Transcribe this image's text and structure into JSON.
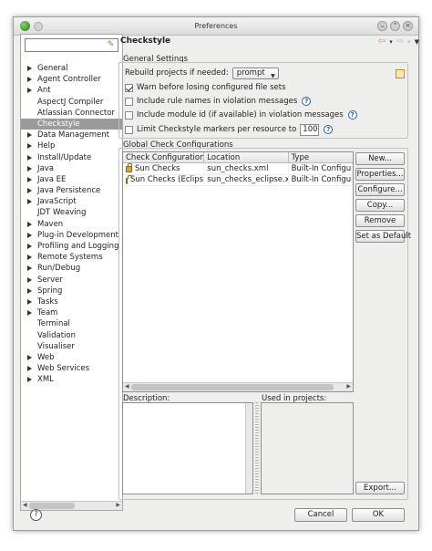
{
  "window": {
    "title": "Preferences"
  },
  "sidebar": {
    "filter_placeholder": "",
    "items": [
      {
        "label": "General",
        "arrow": true,
        "open": false,
        "child": false
      },
      {
        "label": "Agent Controller",
        "arrow": true,
        "open": false,
        "child": false
      },
      {
        "label": "Ant",
        "arrow": true,
        "open": false,
        "child": false
      },
      {
        "label": "AspectJ Compiler",
        "arrow": false,
        "child": true
      },
      {
        "label": "Atlassian Connector",
        "arrow": false,
        "child": true
      },
      {
        "label": "Checkstyle",
        "arrow": false,
        "child": true,
        "selected": true
      },
      {
        "label": "Data Management",
        "arrow": true,
        "open": false,
        "child": false
      },
      {
        "label": "Help",
        "arrow": true,
        "open": false,
        "child": false
      },
      {
        "label": "Install/Update",
        "arrow": true,
        "open": false,
        "child": false
      },
      {
        "label": "Java",
        "arrow": true,
        "open": false,
        "child": false
      },
      {
        "label": "Java EE",
        "arrow": true,
        "open": false,
        "child": false
      },
      {
        "label": "Java Persistence",
        "arrow": true,
        "open": false,
        "child": false
      },
      {
        "label": "JavaScript",
        "arrow": true,
        "open": false,
        "child": false
      },
      {
        "label": "JDT Weaving",
        "arrow": false,
        "child": true
      },
      {
        "label": "Maven",
        "arrow": true,
        "open": false,
        "child": false
      },
      {
        "label": "Plug-in Development",
        "arrow": true,
        "open": false,
        "child": false
      },
      {
        "label": "Profiling and Logging",
        "arrow": true,
        "open": false,
        "child": false
      },
      {
        "label": "Remote Systems",
        "arrow": true,
        "open": false,
        "child": false
      },
      {
        "label": "Run/Debug",
        "arrow": true,
        "open": false,
        "child": false
      },
      {
        "label": "Server",
        "arrow": true,
        "open": false,
        "child": false
      },
      {
        "label": "Spring",
        "arrow": true,
        "open": false,
        "child": false
      },
      {
        "label": "Tasks",
        "arrow": true,
        "open": false,
        "child": false
      },
      {
        "label": "Team",
        "arrow": true,
        "open": false,
        "child": false
      },
      {
        "label": "Terminal",
        "arrow": false,
        "child": true
      },
      {
        "label": "Validation",
        "arrow": false,
        "child": true
      },
      {
        "label": "Visualiser",
        "arrow": false,
        "child": true
      },
      {
        "label": "Web",
        "arrow": true,
        "open": false,
        "child": false
      },
      {
        "label": "Web Services",
        "arrow": true,
        "open": false,
        "child": false
      },
      {
        "label": "XML",
        "arrow": true,
        "open": false,
        "child": false
      }
    ]
  },
  "page": {
    "title": "Checkstyle",
    "nav_icons": [
      "back-arrow-icon",
      "forward-arrow-icon",
      "view-menu-icon"
    ]
  },
  "general_settings": {
    "label": "General Settings",
    "rebuild_label": "Rebuild projects if needed:",
    "rebuild_value": "prompt",
    "warn_label": "Warn before losing configured file sets",
    "warn_checked": true,
    "include_rule_label": "Include rule names in violation messages",
    "include_rule_checked": false,
    "include_module_label": "Include module id (if available) in violation messages",
    "include_module_checked": false,
    "limit_label": "Limit Checkstyle markers per resource to",
    "limit_checked": false,
    "limit_value": "100"
  },
  "global_checks": {
    "label": "Global Check Configurations",
    "columns": [
      "Check Configuration",
      "Location",
      "Type"
    ],
    "rows": [
      {
        "name": "Sun Checks",
        "location": "sun_checks.xml",
        "type": "Built-In Configurat"
      },
      {
        "name": "Sun Checks (Eclipse)",
        "location": "sun_checks_eclipse.xml",
        "type": "Built-In Configurat"
      }
    ],
    "buttons": {
      "new": "New...",
      "properties": "Properties...",
      "configure": "Configure...",
      "copy": "Copy...",
      "remove": "Remove",
      "set_default": "Set as Default",
      "export": "Export..."
    },
    "description_label": "Description:",
    "used_in_label": "Used in projects:"
  },
  "dialog": {
    "help": "?",
    "cancel": "Cancel",
    "ok": "OK"
  },
  "colors": {
    "selection": "#9b9b9b",
    "window_bg": "#eeeeec",
    "help_icon": "#2a5db0",
    "lock_icon": "#d7a535"
  }
}
